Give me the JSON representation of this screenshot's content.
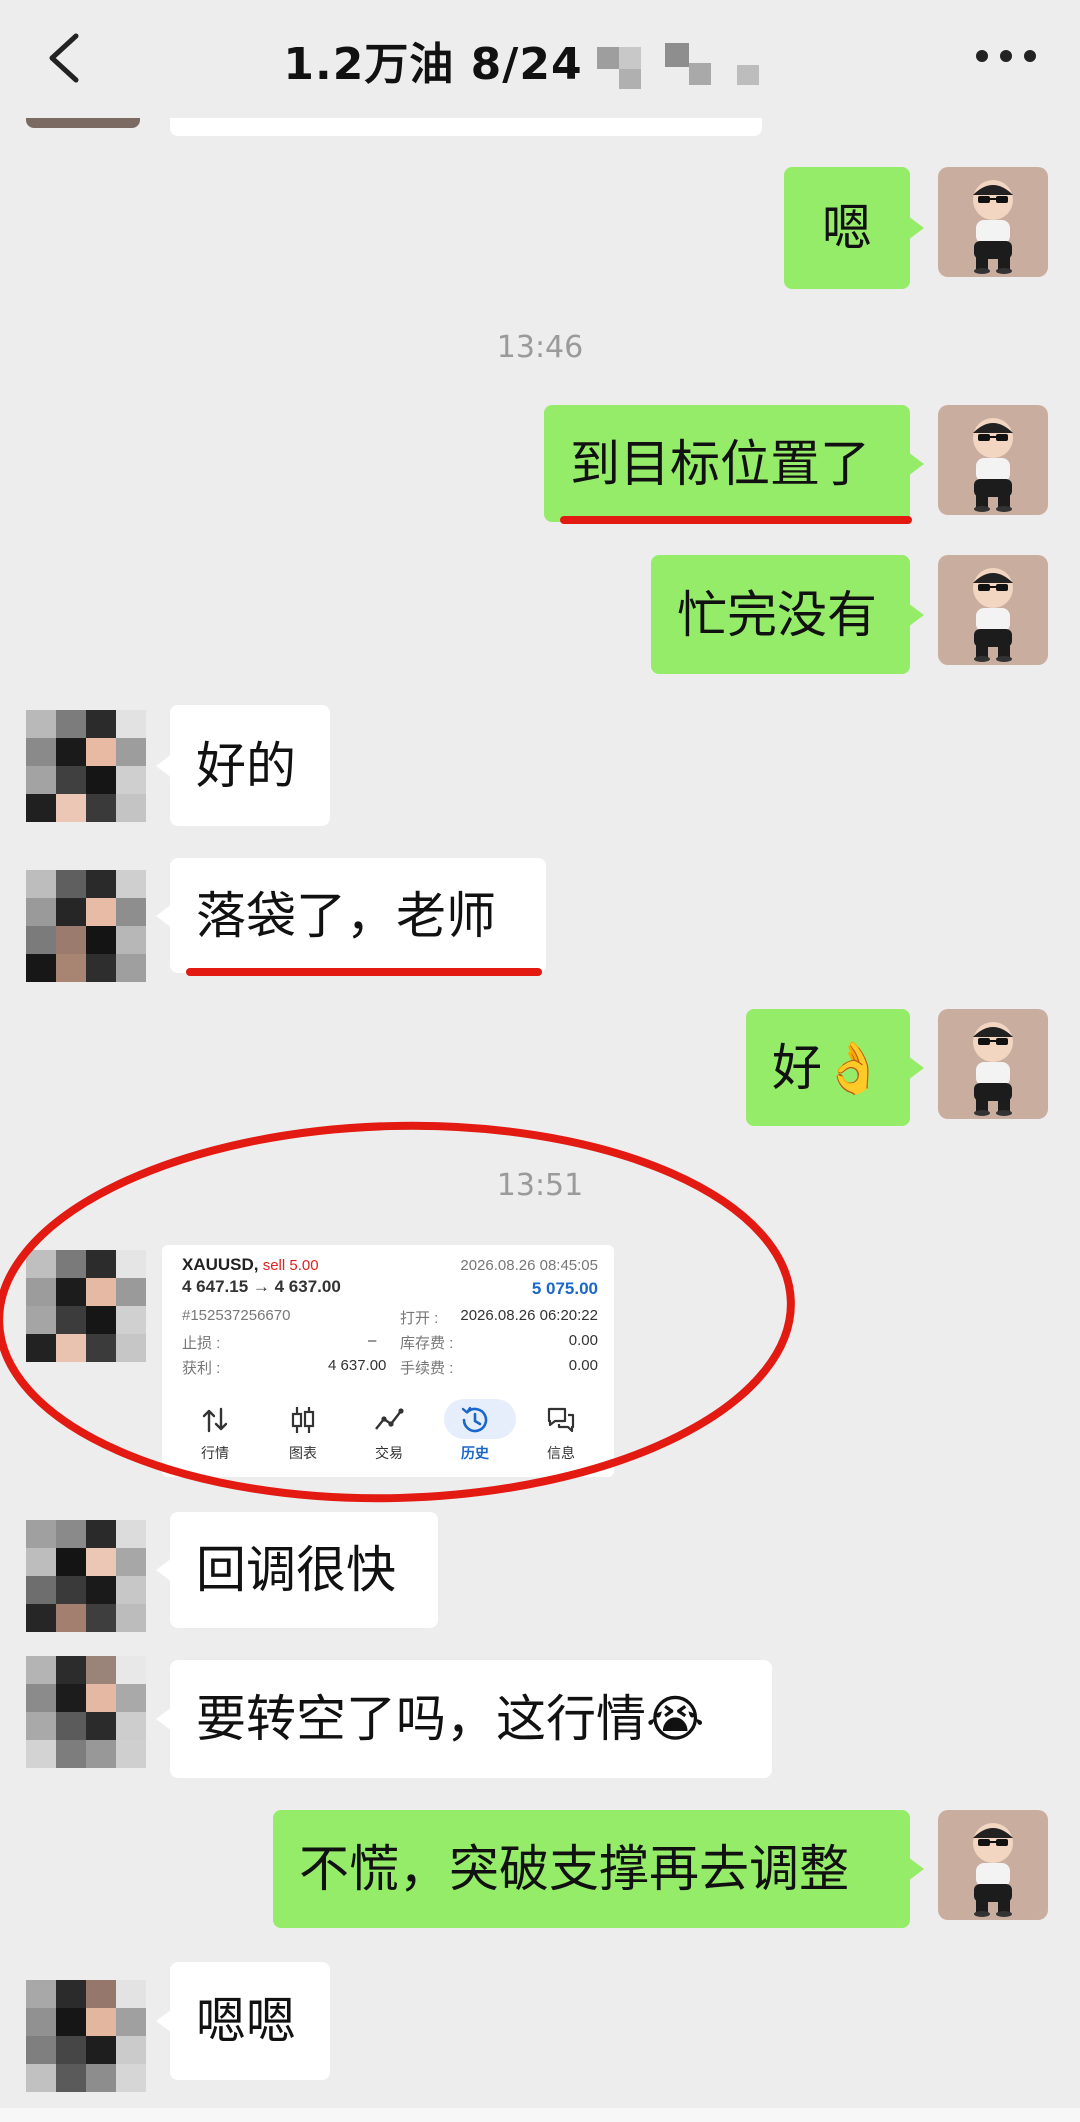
{
  "header": {
    "title": "1.2万油  8/24",
    "back_icon": "chevron-left-icon",
    "more_icon": "more-horizontal-icon"
  },
  "messages": [
    {
      "side": "right",
      "text": "嗯"
    },
    {
      "type": "time",
      "text": "13:46"
    },
    {
      "side": "right",
      "text": "到目标位置了",
      "underlined": true
    },
    {
      "side": "right",
      "text": "忙完没有"
    },
    {
      "side": "left",
      "text": "好的"
    },
    {
      "side": "left",
      "text": "落袋了，老师",
      "underlined": true
    },
    {
      "side": "right",
      "text": "好👌"
    },
    {
      "type": "time",
      "text": "13:51"
    },
    {
      "side": "left",
      "type": "image",
      "circled": true
    },
    {
      "side": "left",
      "text": "回调很快"
    },
    {
      "side": "left",
      "text": "要转空了吗，这行情😭"
    },
    {
      "side": "right",
      "text": "不慌，突破支撑再去调整"
    },
    {
      "side": "left",
      "text": "嗯嗯"
    }
  ],
  "trade_card": {
    "symbol": "XAUUSD,",
    "direction": "sell 5.00",
    "price_path": "4 647.15 → 4 637.00",
    "close_time": "2026.08.26 08:45:05",
    "profit": "5 075.00",
    "order_id": "#152537256670",
    "open_label": "打开 :",
    "open_time": "2026.08.26 06:20:22",
    "sl_label": "止损 :",
    "sl_value": "–",
    "swap_label": "库存费 :",
    "swap_value": "0.00",
    "tp_label": "获利 :",
    "tp_value": "4 637.00",
    "fee_label": "手续费 :",
    "fee_value": "0.00",
    "tabs": [
      "行情",
      "图表",
      "交易",
      "历史",
      "信息"
    ],
    "active_tab": "历史"
  },
  "colors": {
    "background": "#ededed",
    "bubble_self": "#95ec69",
    "bubble_other": "#ffffff",
    "annotation_red": "#e21a12",
    "timestamp": "#9a9a9a",
    "tab_active": "#1a66c9"
  }
}
